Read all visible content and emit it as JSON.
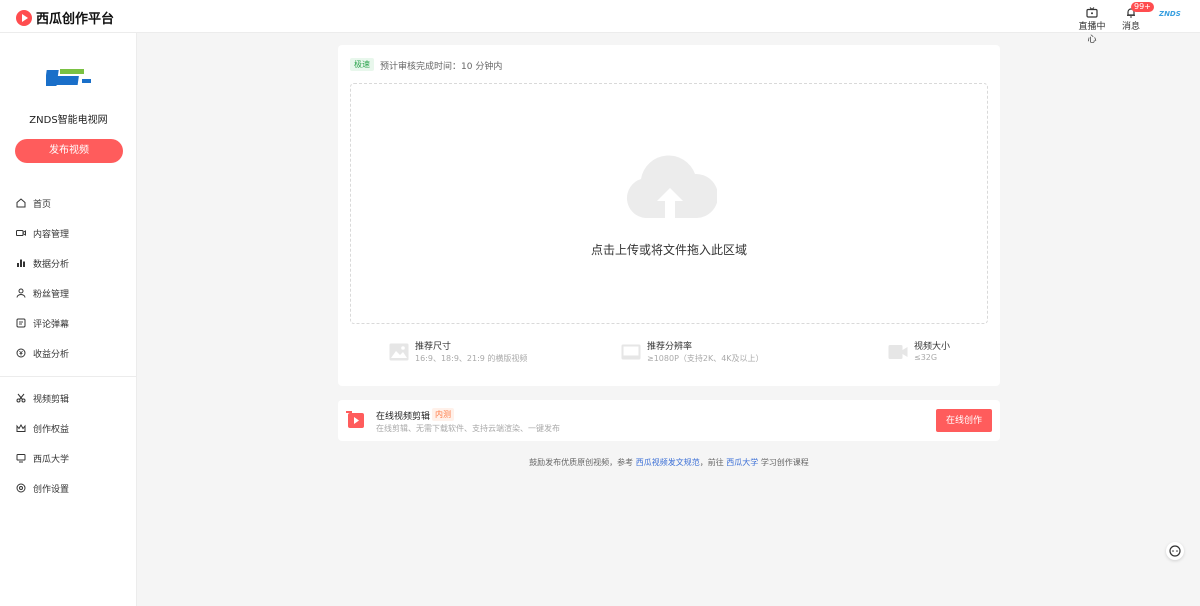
{
  "header": {
    "logo_text": "西瓜创作平台",
    "live_label": "直播中心",
    "message_label": "消息",
    "message_badge": "99+",
    "avatar_text": "ZNDS"
  },
  "sidebar": {
    "channel_name": "ZNDS智能电视网",
    "publish_label": "发布视频",
    "items": [
      {
        "label": "首页"
      },
      {
        "label": "内容管理"
      },
      {
        "label": "数据分析"
      },
      {
        "label": "粉丝管理"
      },
      {
        "label": "评论弹幕"
      },
      {
        "label": "收益分析"
      },
      {
        "label": "视频剪辑"
      },
      {
        "label": "创作权益"
      },
      {
        "label": "西瓜大学"
      },
      {
        "label": "创作设置"
      }
    ]
  },
  "upload": {
    "speed_tag": "极速",
    "speed_text": "预计审核完成时间：10 分钟内",
    "drop_text": "点击上传或将文件拖入此区域",
    "specs": [
      {
        "title": "推荐尺寸",
        "desc": "16:9、18:9、21:9 的横版视频"
      },
      {
        "title": "推荐分辨率",
        "desc": "≥1080P（支持2K、4K及以上）"
      },
      {
        "title": "视频大小",
        "desc": "≤32G"
      }
    ]
  },
  "editor": {
    "title": "在线视频剪辑",
    "tag": "内测",
    "desc": "在线剪辑、无需下载软件、支持云端渲染、一键发布",
    "button": "在线创作"
  },
  "footer": {
    "prefix": "鼓励发布优质原创视频，参考",
    "link1": "西瓜视频发文规范",
    "middle": "，前往",
    "link2": "西瓜大学",
    "suffix": "学习创作课程"
  },
  "colors": {
    "accent": "#ff5c5c",
    "link": "#3b6fd6"
  }
}
